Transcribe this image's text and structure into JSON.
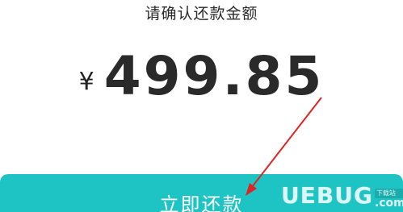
{
  "prompt": "请确认还款金额",
  "amount": {
    "currency": "¥",
    "value": "499.85"
  },
  "button": {
    "label": "立即还款"
  },
  "watermark": {
    "text": "UEBUG",
    "sub": "下载站",
    "suffix": ".com"
  },
  "colors": {
    "button_bg": "#1ec4c3",
    "arrow": "#e02424"
  }
}
